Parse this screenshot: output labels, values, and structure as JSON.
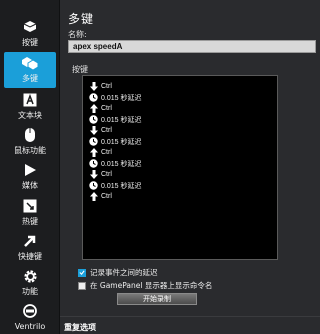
{
  "sidebar": {
    "items": [
      {
        "label": "按键",
        "icon": "keyboard-key-icon"
      },
      {
        "label": "多键",
        "icon": "multikey-icon",
        "active": true
      },
      {
        "label": "文本块",
        "icon": "text-block-icon"
      },
      {
        "label": "鼠标功能",
        "icon": "mouse-icon"
      },
      {
        "label": "媒体",
        "icon": "play-icon"
      },
      {
        "label": "热键",
        "icon": "hotkey-icon"
      },
      {
        "label": "快捷键",
        "icon": "shortcut-arrow-icon"
      },
      {
        "label": "功能",
        "icon": "gear-icon"
      },
      {
        "label": "Ventrilo",
        "icon": "ventrilo-icon"
      }
    ]
  },
  "main": {
    "title": "多键",
    "name_label": "名称:",
    "name_value": "apex speedA",
    "keys_label": "按键",
    "key_events": [
      {
        "type": "down",
        "text": "Ctrl"
      },
      {
        "type": "delay",
        "text": "0.015 秒延迟"
      },
      {
        "type": "up",
        "text": "Ctrl"
      },
      {
        "type": "delay",
        "text": "0.015 秒延迟"
      },
      {
        "type": "down",
        "text": "Ctrl"
      },
      {
        "type": "delay",
        "text": "0.015 秒延迟"
      },
      {
        "type": "up",
        "text": "Ctrl"
      },
      {
        "type": "delay",
        "text": "0.015 秒延迟"
      },
      {
        "type": "down",
        "text": "Ctrl"
      },
      {
        "type": "delay",
        "text": "0.015 秒延迟"
      },
      {
        "type": "up",
        "text": "Ctrl"
      }
    ],
    "option_record_delay": "记录事件之间的延迟",
    "option_record_delay_checked": true,
    "option_show_on_gamepanel": "在 GamePanel 显示器上显示命令名",
    "option_show_on_gamepanel_checked": false,
    "record_button": "开始录制",
    "repeat_title": "重复选项"
  },
  "colors": {
    "accent": "#1b9fd9",
    "background": "#2a2b2e",
    "sidebar": "#1c1d1f"
  }
}
